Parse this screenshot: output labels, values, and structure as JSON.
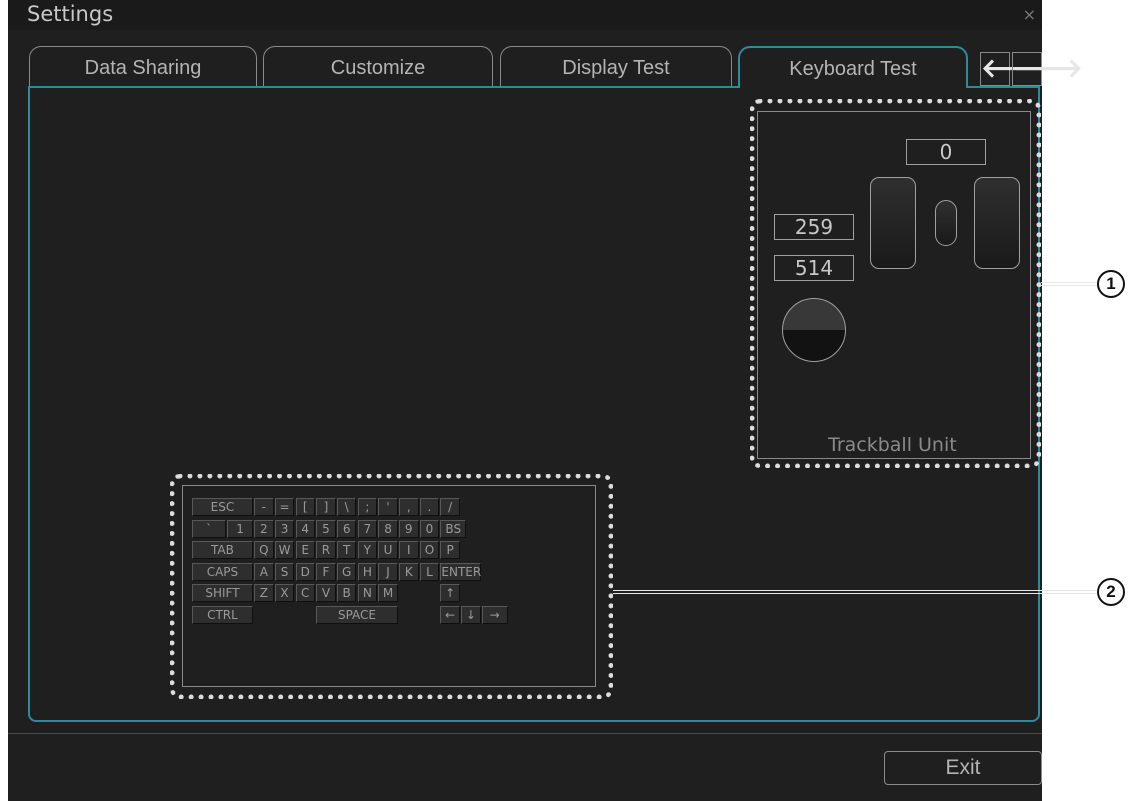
{
  "window": {
    "title": "Settings",
    "close_symbol": "×"
  },
  "tabs": [
    {
      "label": "Data Sharing",
      "active": false
    },
    {
      "label": "Customize",
      "active": false
    },
    {
      "label": "Display Test",
      "active": false
    },
    {
      "label": "Keyboard Test",
      "active": true
    }
  ],
  "tab_nav": {
    "prev_icon": "arrow-left-icon",
    "prev_symbol": "🡐",
    "next_icon": "arrow-right-icon",
    "next_symbol": "🡒"
  },
  "trackball": {
    "label": "Trackball Unit",
    "scroll_value": "0",
    "x_value": "259",
    "y_value": "514"
  },
  "keyboard": {
    "rows": [
      [
        "ESC",
        "-",
        "=",
        "[",
        "]",
        "\\",
        ";",
        "'",
        ",",
        ".",
        "/"
      ],
      [
        "`",
        "1",
        "2",
        "3",
        "4",
        "5",
        "6",
        "7",
        "8",
        "9",
        "0",
        "BS"
      ],
      [
        "TAB",
        "Q",
        "W",
        "E",
        "R",
        "T",
        "Y",
        "U",
        "I",
        "O",
        "P"
      ],
      [
        "CAPS",
        "A",
        "S",
        "D",
        "F",
        "G",
        "H",
        "J",
        "K",
        "L",
        "ENTER"
      ],
      [
        "SHIFT",
        "Z",
        "X",
        "C",
        "V",
        "B",
        "N",
        "M",
        "↑"
      ],
      [
        "CTRL",
        "SPACE",
        "←",
        "↓",
        "→"
      ]
    ]
  },
  "footer": {
    "exit_label": "Exit"
  },
  "callouts": {
    "first": "1",
    "second": "2"
  },
  "colors": {
    "background": "#1f1f1f",
    "accent": "#2c8c9a",
    "text": "#b4b4b4"
  }
}
